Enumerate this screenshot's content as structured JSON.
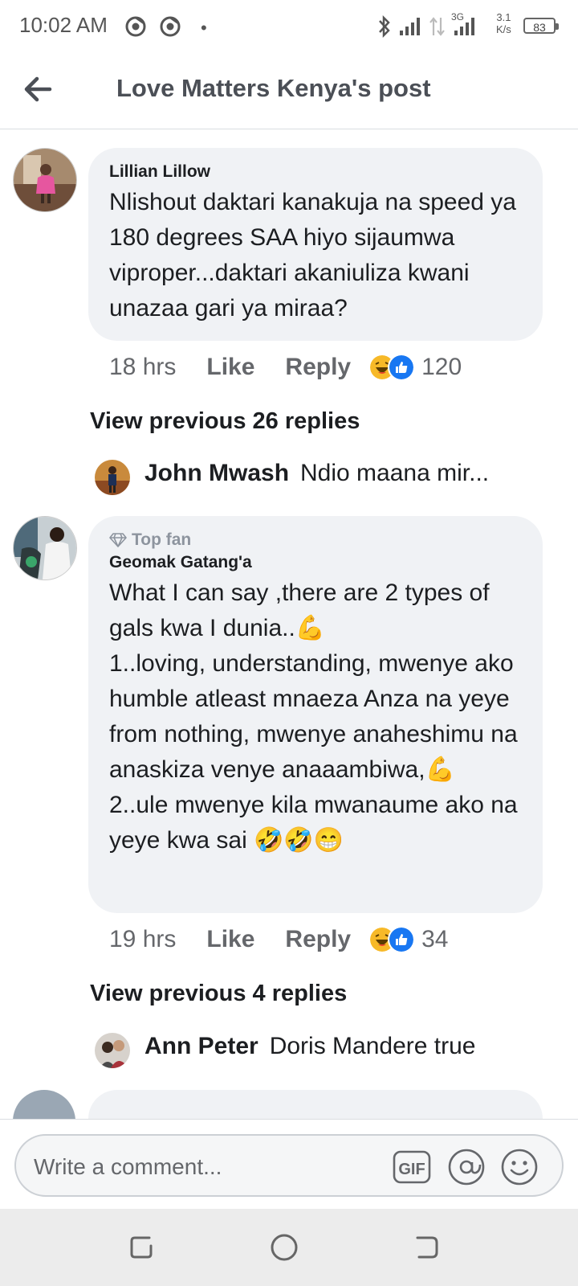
{
  "status_bar": {
    "time": "10:02 AM",
    "dot": "•",
    "network_3g": "3G",
    "speed_value": "3.1",
    "speed_unit": "K/s",
    "battery": "83",
    "icons": [
      "chrome-icon",
      "chrome-icon",
      "bluetooth-icon",
      "signal-icon",
      "data-arrows-icon",
      "signal-3g-icon"
    ]
  },
  "header": {
    "title": "Love Matters Kenya's post",
    "back_icon": "back-arrow-icon"
  },
  "comments": [
    {
      "author": "Lillian Lillow",
      "text": "Nlishout daktari kanakuja na speed ya 180 degrees SAA hiyo sijaumwa viproper...daktari akaniuliza kwani unazaa gari ya miraa?",
      "time": "18 hrs",
      "like_label": "Like",
      "reply_label": "Reply",
      "reaction_count": "120",
      "reactions": [
        "haha-icon",
        "like-icon"
      ],
      "view_previous": "View previous 26 replies",
      "latest_reply": {
        "author": "John Mwash",
        "text": "Ndio maana mir..."
      }
    },
    {
      "badge": "Top fan",
      "badge_icon": "diamond-icon",
      "author": "Geomak Gatang'a",
      "text": "What I can say ,there are 2 types of gals kwa I dunia..💪\n1..loving, understanding, mwenye ako humble atleast mnaeza Anza na yeye from nothing, mwenye anaheshimu na anaskiza venye anaaambiwa,💪\n2..ule mwenye kila mwanaume ako na yeye kwa sai 🤣🤣😁",
      "time": "19 hrs",
      "like_label": "Like",
      "reply_label": "Reply",
      "reaction_count": "34",
      "reactions": [
        "haha-icon",
        "like-icon"
      ],
      "view_previous": "View previous 4 replies",
      "latest_reply": {
        "author": "Ann Peter",
        "text": "Doris Mandere true"
      }
    }
  ],
  "composer": {
    "placeholder": "Write a comment...",
    "gif_label": "GIF",
    "icons": [
      "gif-icon",
      "mention-icon",
      "emoji-icon"
    ]
  },
  "colors": {
    "bubble_bg": "#f0f2f5",
    "secondary_text": "#65676b",
    "like_blue": "#1877f2",
    "haha_yellow": "#f7b928"
  }
}
